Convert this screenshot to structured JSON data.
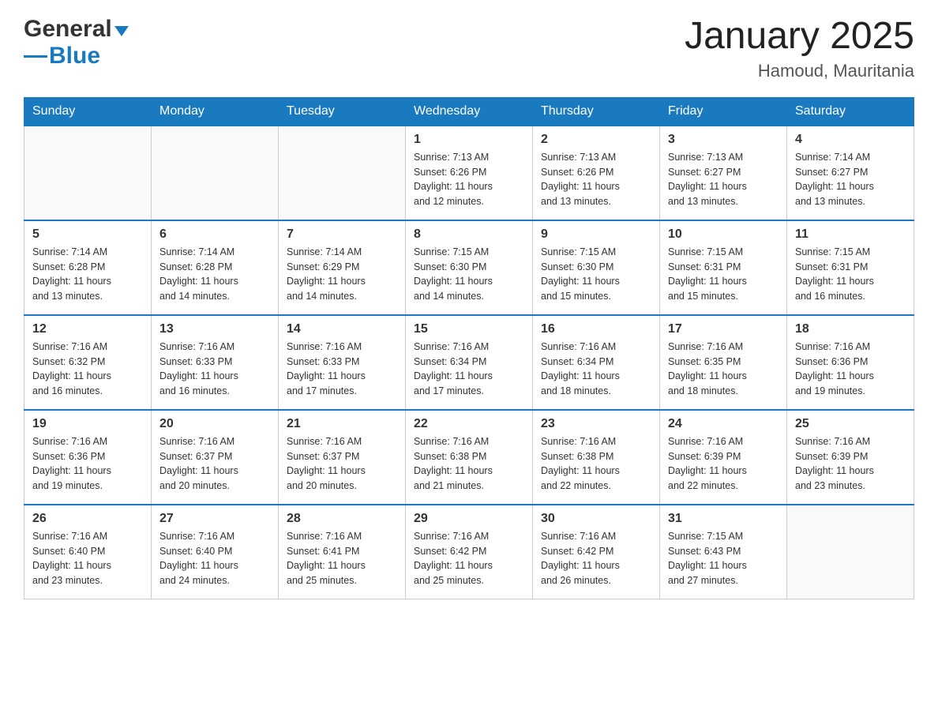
{
  "header": {
    "logo_general": "General",
    "logo_blue": "Blue",
    "month_title": "January 2025",
    "location": "Hamoud, Mauritania"
  },
  "days_of_week": [
    "Sunday",
    "Monday",
    "Tuesday",
    "Wednesday",
    "Thursday",
    "Friday",
    "Saturday"
  ],
  "weeks": [
    [
      {
        "day": "",
        "info": ""
      },
      {
        "day": "",
        "info": ""
      },
      {
        "day": "",
        "info": ""
      },
      {
        "day": "1",
        "info": "Sunrise: 7:13 AM\nSunset: 6:26 PM\nDaylight: 11 hours\nand 12 minutes."
      },
      {
        "day": "2",
        "info": "Sunrise: 7:13 AM\nSunset: 6:26 PM\nDaylight: 11 hours\nand 13 minutes."
      },
      {
        "day": "3",
        "info": "Sunrise: 7:13 AM\nSunset: 6:27 PM\nDaylight: 11 hours\nand 13 minutes."
      },
      {
        "day": "4",
        "info": "Sunrise: 7:14 AM\nSunset: 6:27 PM\nDaylight: 11 hours\nand 13 minutes."
      }
    ],
    [
      {
        "day": "5",
        "info": "Sunrise: 7:14 AM\nSunset: 6:28 PM\nDaylight: 11 hours\nand 13 minutes."
      },
      {
        "day": "6",
        "info": "Sunrise: 7:14 AM\nSunset: 6:28 PM\nDaylight: 11 hours\nand 14 minutes."
      },
      {
        "day": "7",
        "info": "Sunrise: 7:14 AM\nSunset: 6:29 PM\nDaylight: 11 hours\nand 14 minutes."
      },
      {
        "day": "8",
        "info": "Sunrise: 7:15 AM\nSunset: 6:30 PM\nDaylight: 11 hours\nand 14 minutes."
      },
      {
        "day": "9",
        "info": "Sunrise: 7:15 AM\nSunset: 6:30 PM\nDaylight: 11 hours\nand 15 minutes."
      },
      {
        "day": "10",
        "info": "Sunrise: 7:15 AM\nSunset: 6:31 PM\nDaylight: 11 hours\nand 15 minutes."
      },
      {
        "day": "11",
        "info": "Sunrise: 7:15 AM\nSunset: 6:31 PM\nDaylight: 11 hours\nand 16 minutes."
      }
    ],
    [
      {
        "day": "12",
        "info": "Sunrise: 7:16 AM\nSunset: 6:32 PM\nDaylight: 11 hours\nand 16 minutes."
      },
      {
        "day": "13",
        "info": "Sunrise: 7:16 AM\nSunset: 6:33 PM\nDaylight: 11 hours\nand 16 minutes."
      },
      {
        "day": "14",
        "info": "Sunrise: 7:16 AM\nSunset: 6:33 PM\nDaylight: 11 hours\nand 17 minutes."
      },
      {
        "day": "15",
        "info": "Sunrise: 7:16 AM\nSunset: 6:34 PM\nDaylight: 11 hours\nand 17 minutes."
      },
      {
        "day": "16",
        "info": "Sunrise: 7:16 AM\nSunset: 6:34 PM\nDaylight: 11 hours\nand 18 minutes."
      },
      {
        "day": "17",
        "info": "Sunrise: 7:16 AM\nSunset: 6:35 PM\nDaylight: 11 hours\nand 18 minutes."
      },
      {
        "day": "18",
        "info": "Sunrise: 7:16 AM\nSunset: 6:36 PM\nDaylight: 11 hours\nand 19 minutes."
      }
    ],
    [
      {
        "day": "19",
        "info": "Sunrise: 7:16 AM\nSunset: 6:36 PM\nDaylight: 11 hours\nand 19 minutes."
      },
      {
        "day": "20",
        "info": "Sunrise: 7:16 AM\nSunset: 6:37 PM\nDaylight: 11 hours\nand 20 minutes."
      },
      {
        "day": "21",
        "info": "Sunrise: 7:16 AM\nSunset: 6:37 PM\nDaylight: 11 hours\nand 20 minutes."
      },
      {
        "day": "22",
        "info": "Sunrise: 7:16 AM\nSunset: 6:38 PM\nDaylight: 11 hours\nand 21 minutes."
      },
      {
        "day": "23",
        "info": "Sunrise: 7:16 AM\nSunset: 6:38 PM\nDaylight: 11 hours\nand 22 minutes."
      },
      {
        "day": "24",
        "info": "Sunrise: 7:16 AM\nSunset: 6:39 PM\nDaylight: 11 hours\nand 22 minutes."
      },
      {
        "day": "25",
        "info": "Sunrise: 7:16 AM\nSunset: 6:39 PM\nDaylight: 11 hours\nand 23 minutes."
      }
    ],
    [
      {
        "day": "26",
        "info": "Sunrise: 7:16 AM\nSunset: 6:40 PM\nDaylight: 11 hours\nand 23 minutes."
      },
      {
        "day": "27",
        "info": "Sunrise: 7:16 AM\nSunset: 6:40 PM\nDaylight: 11 hours\nand 24 minutes."
      },
      {
        "day": "28",
        "info": "Sunrise: 7:16 AM\nSunset: 6:41 PM\nDaylight: 11 hours\nand 25 minutes."
      },
      {
        "day": "29",
        "info": "Sunrise: 7:16 AM\nSunset: 6:42 PM\nDaylight: 11 hours\nand 25 minutes."
      },
      {
        "day": "30",
        "info": "Sunrise: 7:16 AM\nSunset: 6:42 PM\nDaylight: 11 hours\nand 26 minutes."
      },
      {
        "day": "31",
        "info": "Sunrise: 7:15 AM\nSunset: 6:43 PM\nDaylight: 11 hours\nand 27 minutes."
      },
      {
        "day": "",
        "info": ""
      }
    ]
  ]
}
